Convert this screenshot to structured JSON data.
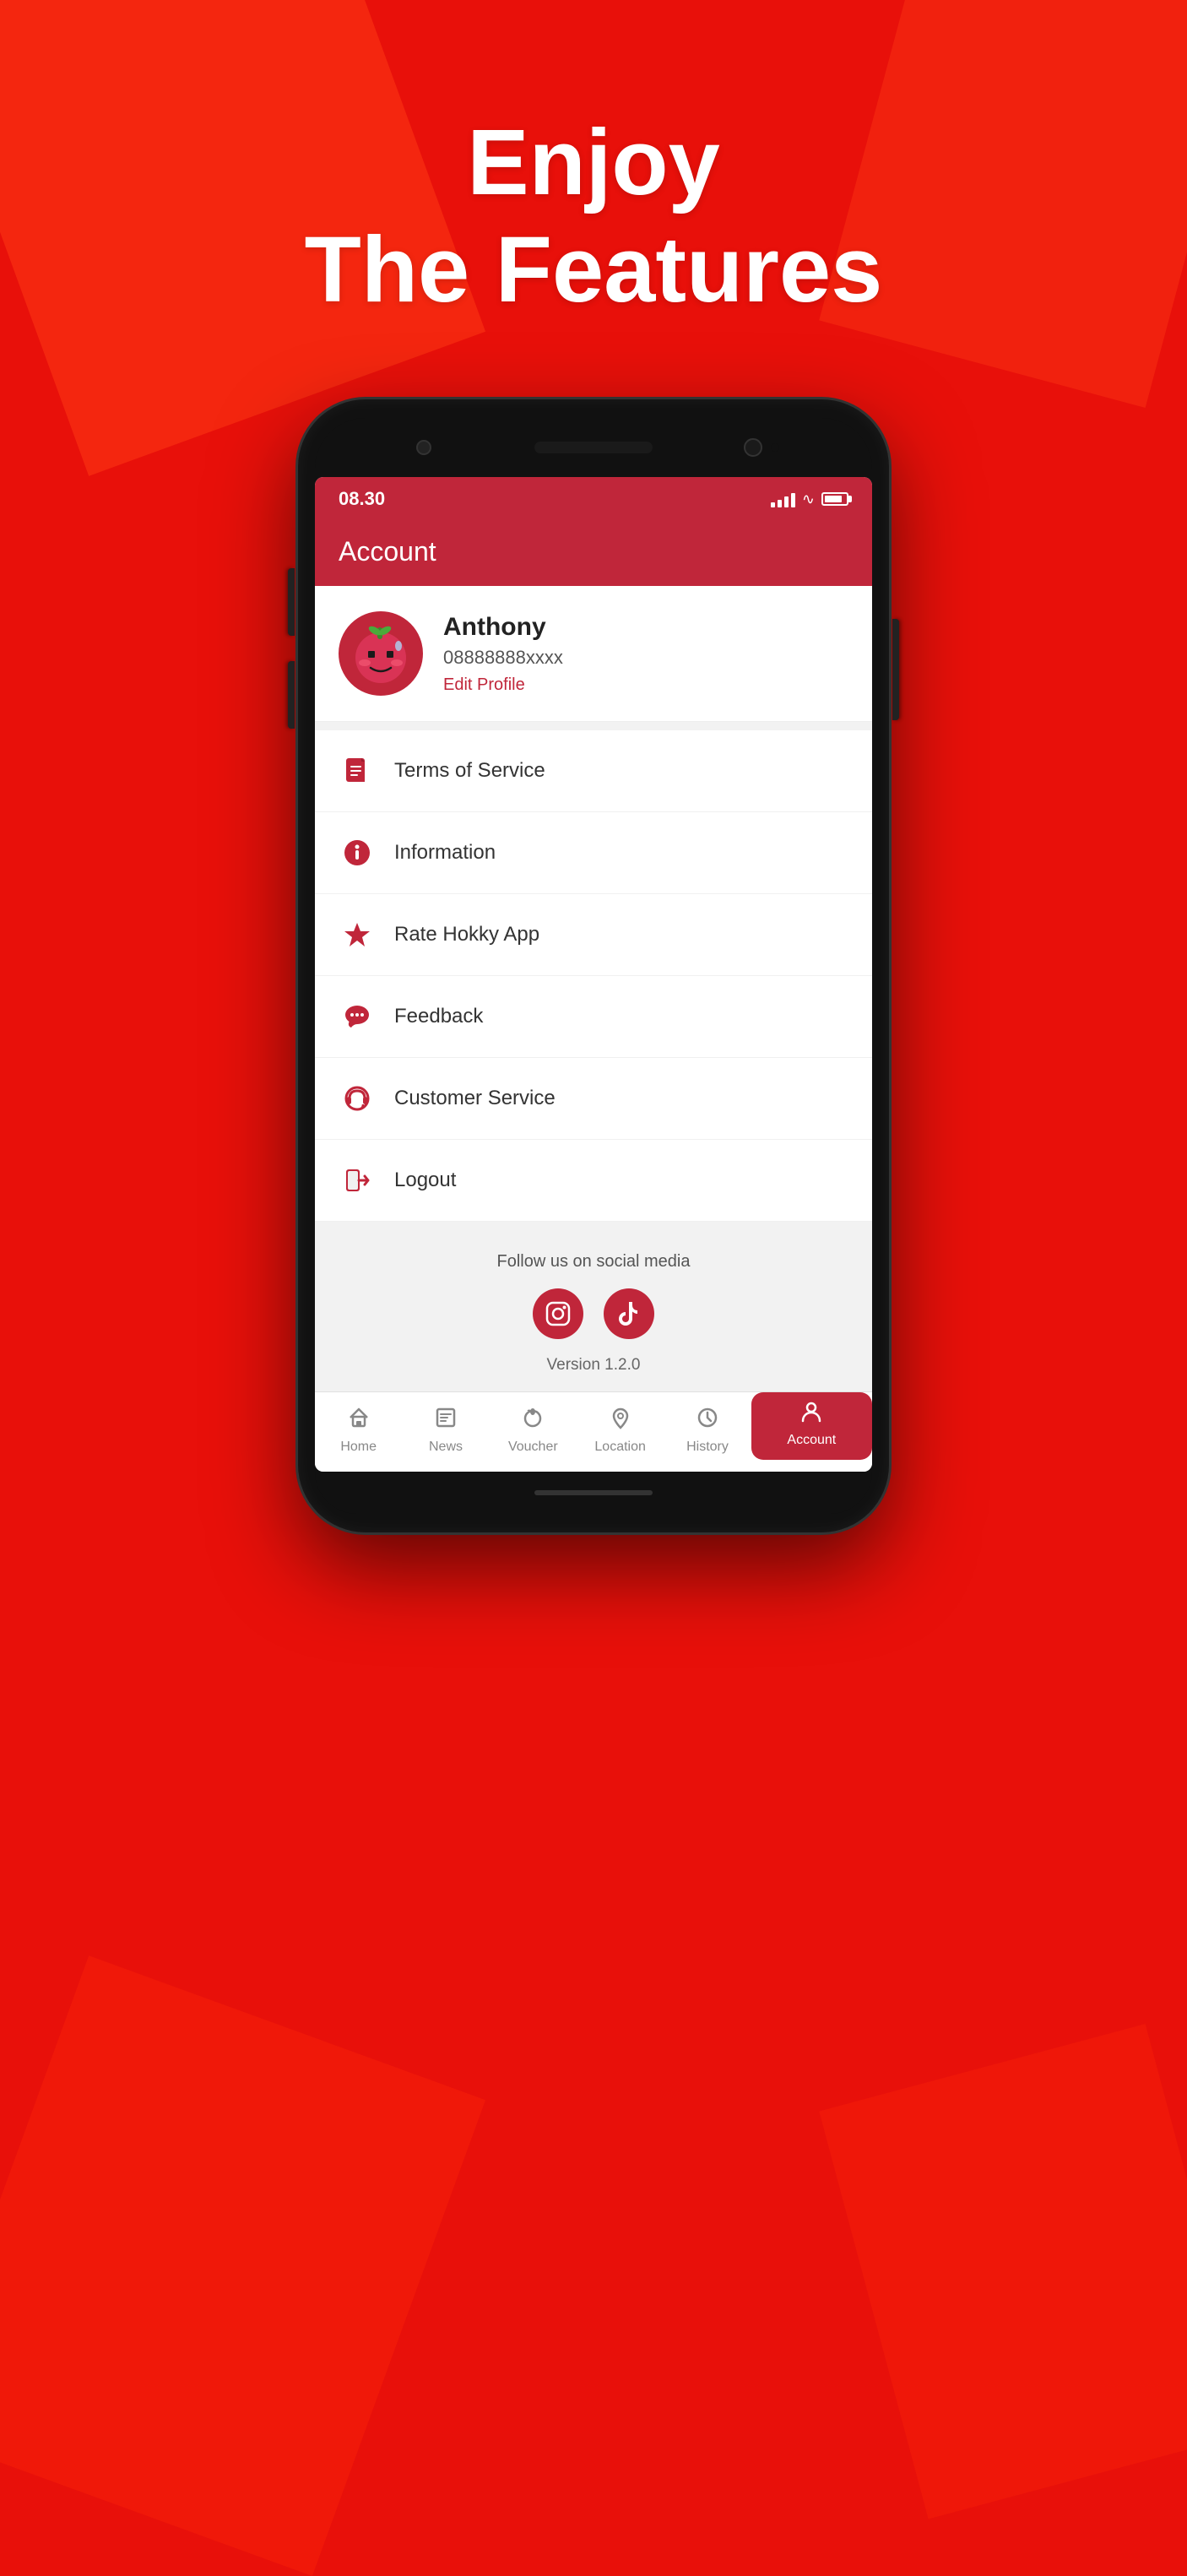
{
  "hero": {
    "line1": "Enjoy",
    "line2": "The Features"
  },
  "phone": {
    "statusBar": {
      "time": "08.30"
    },
    "header": {
      "title": "Account"
    },
    "profile": {
      "name": "Anthony",
      "phone": "08888888xxxx",
      "editLabel": "Edit Profile"
    },
    "menuItems": [
      {
        "id": "terms",
        "label": "Terms of Service",
        "icon": "📄"
      },
      {
        "id": "information",
        "label": "Information",
        "icon": "ℹ️"
      },
      {
        "id": "rate",
        "label": "Rate Hokky App",
        "icon": "⭐"
      },
      {
        "id": "feedback",
        "label": "Feedback",
        "icon": "💬"
      },
      {
        "id": "customer-service",
        "label": "Customer Service",
        "icon": "🎧"
      },
      {
        "id": "logout",
        "label": "Logout",
        "icon": "🚪"
      }
    ],
    "social": {
      "followText": "Follow us on social media",
      "version": "Version 1.2.0"
    },
    "bottomNav": [
      {
        "id": "home",
        "label": "Home",
        "icon": "🏠",
        "active": false
      },
      {
        "id": "news",
        "label": "News",
        "icon": "📰",
        "active": false
      },
      {
        "id": "voucher",
        "label": "Voucher",
        "icon": "🍎",
        "active": false
      },
      {
        "id": "location",
        "label": "Location",
        "icon": "📍",
        "active": false
      },
      {
        "id": "history",
        "label": "History",
        "icon": "🕐",
        "active": false
      },
      {
        "id": "account",
        "label": "Account",
        "icon": "👤",
        "active": true
      }
    ]
  },
  "colors": {
    "primary": "#c0263a",
    "background": "#e8100a"
  }
}
